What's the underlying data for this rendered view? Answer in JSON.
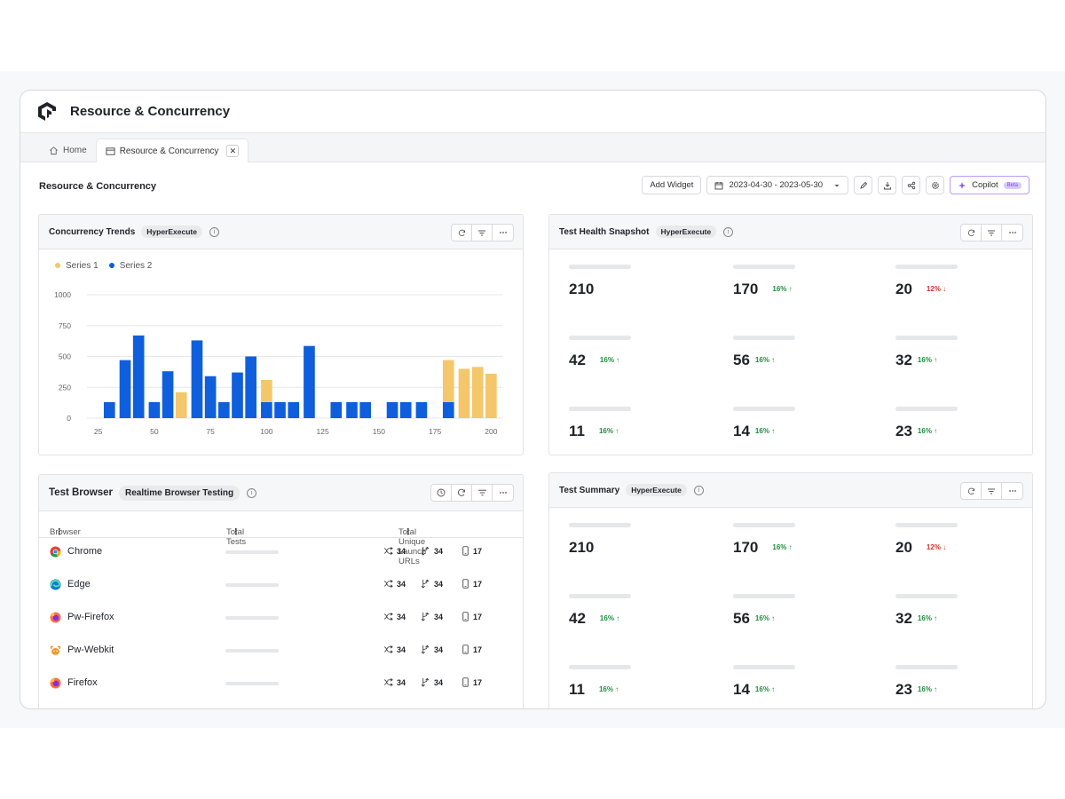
{
  "app": {
    "title": "Resource & Concurrency"
  },
  "tabs": [
    {
      "label": "Home"
    },
    {
      "label": "Resource & Concurrency",
      "close": "✕"
    }
  ],
  "toolbar": {
    "page_title": "Resource & Concurrency",
    "add_widget": "Add Widget",
    "date_range": "2023-04-30 - 2023-05-30",
    "copilot": "Copilot",
    "beta": "Beta"
  },
  "concurrency": {
    "title": "Concurrency Trends",
    "chip": "HyperExecute",
    "info": "i"
  },
  "health": {
    "title": "Test Health Snapshot",
    "chip": "HyperExecute",
    "info": "i",
    "stats": [
      {
        "value": "210",
        "delta": ""
      },
      {
        "value": "170",
        "delta": "16% ↑",
        "dir": "up"
      },
      {
        "value": "20",
        "delta": "12% ↓",
        "dir": "down"
      },
      {
        "value": "42",
        "delta": "16% ↑",
        "dir": "up"
      },
      {
        "value": "56",
        "delta": "16% ↑",
        "dir": "up"
      },
      {
        "value": "32",
        "delta": "16% ↑",
        "dir": "up"
      },
      {
        "value": "11",
        "delta": "16% ↑",
        "dir": "up"
      },
      {
        "value": "14",
        "delta": "16% ↑",
        "dir": "up"
      },
      {
        "value": "23",
        "delta": "16% ↑",
        "dir": "up"
      }
    ]
  },
  "browser": {
    "title": "Test Browser",
    "chip": "Realtime Browser Testing",
    "info": "i",
    "columns": {
      "browser": "Browser",
      "total": "Total Tests",
      "unique": "Total Unique Launch URLs",
      "kebab": "⋮"
    },
    "rows": [
      {
        "name": "Chrome",
        "icon": "chrome-icon",
        "a": "34",
        "b": "34",
        "c": "17"
      },
      {
        "name": "Edge",
        "icon": "edge-icon",
        "a": "34",
        "b": "34",
        "c": "17"
      },
      {
        "name": "Pw-Firefox",
        "icon": "firefox-icon",
        "a": "34",
        "b": "34",
        "c": "17"
      },
      {
        "name": "Pw-Webkit",
        "icon": "webkit-icon",
        "a": "34",
        "b": "34",
        "c": "17"
      },
      {
        "name": "Firefox",
        "icon": "firefox-icon",
        "a": "34",
        "b": "34",
        "c": "17"
      }
    ]
  },
  "summary": {
    "title": "Test Summary",
    "chip": "HyperExecute",
    "info": "i",
    "stats": [
      {
        "value": "210",
        "delta": ""
      },
      {
        "value": "170",
        "delta": "16% ↑",
        "dir": "up"
      },
      {
        "value": "20",
        "delta": "12% ↓",
        "dir": "down"
      },
      {
        "value": "42",
        "delta": "16% ↑",
        "dir": "up"
      },
      {
        "value": "56",
        "delta": "16% ↑",
        "dir": "up"
      },
      {
        "value": "32",
        "delta": "16% ↑",
        "dir": "up"
      },
      {
        "value": "11",
        "delta": "16% ↑",
        "dir": "up"
      },
      {
        "value": "14",
        "delta": "16% ↑",
        "dir": "up"
      },
      {
        "value": "23",
        "delta": "16% ↑",
        "dir": "up"
      }
    ]
  },
  "colors": {
    "series1": "#f4c76b",
    "series2": "#0f5fdc"
  },
  "chart_data": {
    "type": "bar",
    "title": "",
    "xlabel": "",
    "ylabel": "",
    "xlim": [
      20,
      205
    ],
    "ylim": [
      0,
      1000
    ],
    "x_ticks": [
      25,
      50,
      75,
      100,
      125,
      150,
      175,
      200
    ],
    "y_ticks": [
      0,
      250,
      500,
      750,
      1000
    ],
    "legend_position": "top-left",
    "grid": true,
    "bar_width": 5,
    "series": [
      {
        "name": "Series 1",
        "color": "#f4c76b",
        "x": [
          37,
          43,
          50,
          56,
          62,
          69,
          75,
          81,
          87,
          93,
          100,
          106,
          112,
          119,
          125,
          131,
          138,
          144,
          150,
          156,
          162,
          169,
          175,
          181,
          188,
          194,
          200
        ],
        "values": [
          0,
          0,
          0,
          0,
          210,
          0,
          0,
          0,
          0,
          0,
          310,
          0,
          0,
          0,
          0,
          0,
          0,
          0,
          0,
          0,
          0,
          0,
          0,
          470,
          400,
          415,
          360
        ]
      },
      {
        "name": "Series 2",
        "color": "#0f5fdc",
        "x": [
          30,
          37,
          43,
          50,
          56,
          62,
          69,
          75,
          81,
          87,
          93,
          100,
          106,
          112,
          119,
          131,
          138,
          144,
          156,
          162,
          169,
          181
        ],
        "values": [
          130,
          470,
          670,
          130,
          380,
          0,
          630,
          340,
          130,
          370,
          500,
          130,
          130,
          130,
          585,
          130,
          130,
          130,
          130,
          130,
          130,
          130
        ]
      }
    ]
  }
}
